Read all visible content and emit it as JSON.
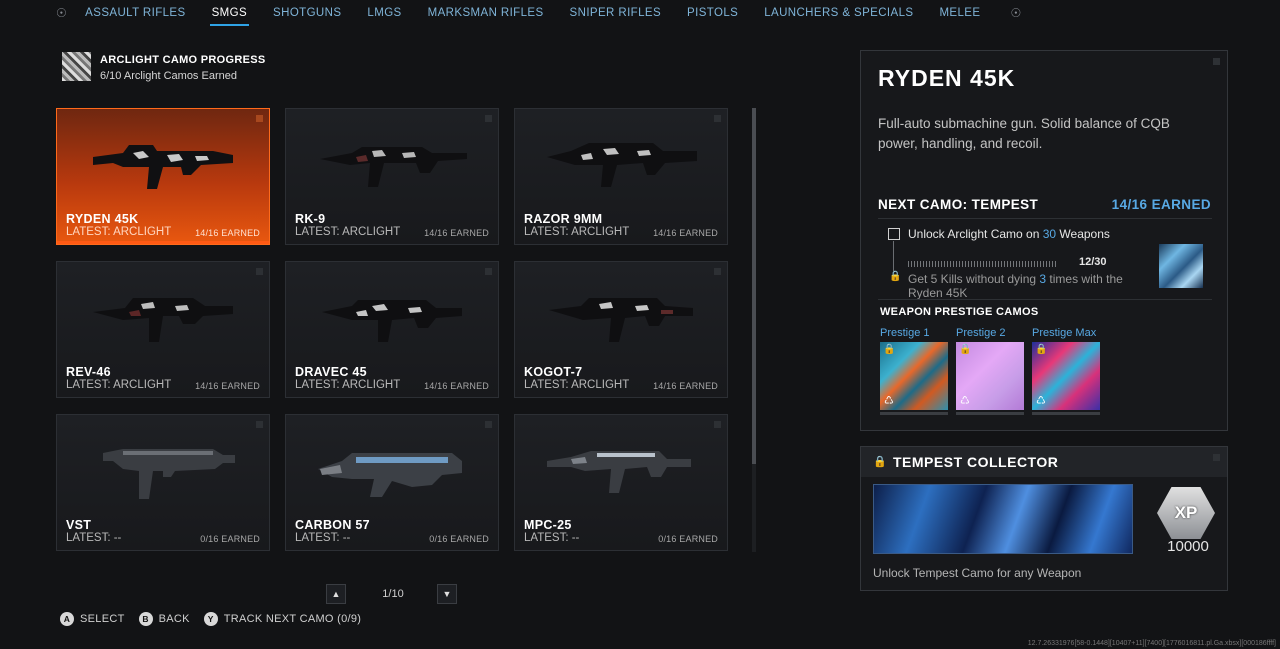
{
  "nav": {
    "tabs": [
      {
        "label": "ASSAULT RIFLES"
      },
      {
        "label": "SMGS"
      },
      {
        "label": "SHOTGUNS"
      },
      {
        "label": "LMGS"
      },
      {
        "label": "MARKSMAN RIFLES"
      },
      {
        "label": "SNIPER RIFLES"
      },
      {
        "label": "PISTOLS"
      },
      {
        "label": "LAUNCHERS & SPECIALS"
      },
      {
        "label": "MELEE"
      }
    ],
    "active_tab": "SMGS",
    "left_icon": "shoulder-left-icon",
    "right_icon": "shoulder-right-icon"
  },
  "progress": {
    "title": "ARCLIGHT CAMO PROGRESS",
    "subtitle": "6/10 Arclight Camos Earned"
  },
  "weapons": [
    {
      "name": "RYDEN 45K",
      "latest": "LATEST: ARCLIGHT",
      "earned": "14/16 EARNED",
      "selected": true
    },
    {
      "name": "RK-9",
      "latest": "LATEST: ARCLIGHT",
      "earned": "14/16 EARNED"
    },
    {
      "name": "RAZOR 9MM",
      "latest": "LATEST: ARCLIGHT",
      "earned": "14/16 EARNED"
    },
    {
      "name": "REV-46",
      "latest": "LATEST: ARCLIGHT",
      "earned": "14/16 EARNED"
    },
    {
      "name": "DRAVEC 45",
      "latest": "LATEST: ARCLIGHT",
      "earned": "14/16 EARNED"
    },
    {
      "name": "KOGOT-7",
      "latest": "LATEST: ARCLIGHT",
      "earned": "14/16 EARNED"
    },
    {
      "name": "VST",
      "latest": "LATEST: --",
      "earned": "0/16 EARNED"
    },
    {
      "name": "CARBON 57",
      "latest": "LATEST: --",
      "earned": "0/16 EARNED"
    },
    {
      "name": "MPC-25",
      "latest": "LATEST: --",
      "earned": "0/16 EARNED"
    }
  ],
  "pager": {
    "label": "1/10"
  },
  "footer": {
    "select": {
      "key": "A",
      "label": "SELECT"
    },
    "back": {
      "key": "B",
      "label": "BACK"
    },
    "track": {
      "key": "Y",
      "label": "TRACK NEXT CAMO (0/9)"
    }
  },
  "detail": {
    "title": "RYDEN 45K",
    "description": "Full-auto submachine gun. Solid balance of CQB power, handling, and recoil.",
    "next_camo": "NEXT CAMO: TEMPEST",
    "next_count": "14/16 EARNED",
    "challenge1": {
      "prefix": "Unlock Arclight Camo on ",
      "num": "30",
      "suffix": " Weapons"
    },
    "challenge1_progress": 0.4,
    "challenge_count": "12/30",
    "challenge2": {
      "prefix": "Get 5 Kills without dying ",
      "num": "3",
      "suffix": " times with the Ryden 45K"
    },
    "prestige_header": "WEAPON PRESTIGE CAMOS",
    "prestige": [
      {
        "label": "Prestige 1"
      },
      {
        "label": "Prestige 2"
      },
      {
        "label": "Prestige Max"
      }
    ]
  },
  "collector": {
    "title": "TEMPEST COLLECTOR",
    "badge": "XP",
    "xp": "10000",
    "description": "Unlock Tempest Camo for any Weapon"
  },
  "debug": "12.7.26331976[58-0.1448][10407+11][7400][1776016811.pl.Ga.xbsx][000186ffff]",
  "colors": {
    "accent": "#2fa3e6",
    "highlight": "#58a9e4",
    "selected": "#e9580f"
  }
}
